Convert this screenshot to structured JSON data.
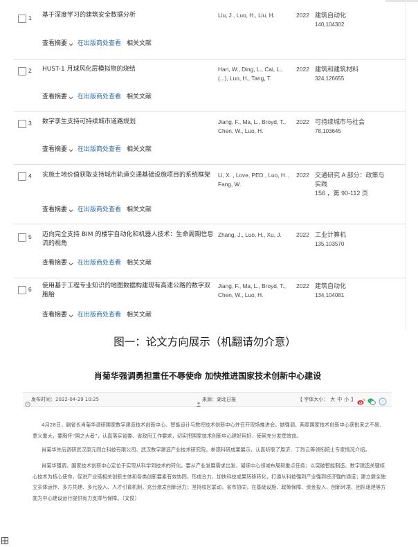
{
  "results": [
    {
      "index": "1",
      "title_lines": [
        "基于深度学习的建筑安全数据分析"
      ],
      "author_lines": [
        "Liu, J., Luo, H., Liu, H."
      ],
      "year": "2022",
      "source_lines": [
        "建筑自动化",
        "140,104302"
      ]
    },
    {
      "index": "2",
      "title_lines": [
        "HUST-1 月球风化层模拟物的烧结"
      ],
      "author_lines": [
        "Han, W., Ding, L., Cai, L.,",
        "(...), Luo, H., Tang, T."
      ],
      "year": "2022",
      "source_lines": [
        "建筑和建筑材料",
        "324,126655"
      ]
    },
    {
      "index": "3",
      "title_lines": [
        "数字孪生支持可持续城市道路规划"
      ],
      "author_lines": [
        "Jiang, F., Ma, L., Broyd, T.,",
        "Chen, W., Luo, H."
      ],
      "year": "2022",
      "source_lines": [
        "可持续城市与社会",
        "78,103645"
      ]
    },
    {
      "index": "4",
      "title_lines": [
        "实施土地价值获取支持城市轨道交通基础设施项目的系统框架"
      ],
      "author_lines": [
        "Li, X. , Love, PED , Luo, H. ,",
        "Fang, W."
      ],
      "year": "2022",
      "source_lines": [
        "交通研究 A 部分：政策与",
        "实践",
        "156 ，第 90-112 页"
      ]
    },
    {
      "index": "5",
      "title_lines": [
        "迈向完全支持 BIM 的楼宇自动化和机器人技术：生命周期信息",
        "流的视角"
      ],
      "author_lines": [
        "Zhang, J., Luo, H., Xu, J."
      ],
      "year": "2022",
      "source_lines": [
        "工业计算机",
        "135,103570"
      ]
    },
    {
      "index": "6",
      "title_lines": [
        "使用基于工程专业知识的地图数据构建现有高速公路的数字双",
        "胞胎"
      ],
      "author_lines": [
        "Jiang, F., Ma, L., Broyd, T.,",
        "Chen, W., Luo, H."
      ],
      "year": "2022",
      "source_lines": [
        "建筑自动化",
        "134,104081"
      ]
    }
  ],
  "result_actions": {
    "abstract": "查看摘要",
    "abstract_icon": "chevron-down-icon",
    "publisher": "在出版商处查看",
    "related": "相关文献"
  },
  "caption_1": "图一：论文方向展示（机翻请勿介意）",
  "news": {
    "title": "肖菊华强调勇担重任不辱使命 加快推进国家技术创新中心建设",
    "published": "发布时间：2022-04-29 10:25",
    "published_icon": "clock-icon",
    "source": "来源：湖北日报",
    "source_icon": "source-icon",
    "font_size": {
      "label": "【 字体大小：",
      "large": "大",
      "medium": "中",
      "small": "小",
      "end": "】"
    },
    "share_icons": [
      "weibo-icon",
      "wechat-icon",
      "qzone-icon"
    ],
    "paragraphs": [
      [
        "4月28日，副省长肖菊华调研国家数字建造技术创新中心、智能设计与数控技术创新中心并召开现场推进会。她强调，两家国家技术创新中心获批来之不易、",
        "意义重大，要胸怀“国之大者”，认真落实省委、省政府工作要求，切实把国家技术创新中心建好用好，使其充分发挥效益。"
      ],
      [
        "肖菊华先后调研武汉原元同立科技有限公司、武汉数字建造产业技术研究院，参观科研成果展示，认真听取了周济、丁烈云等领衔院士专家情况介绍。"
      ],
      [
        "肖菊华强调，国家技术创新中心定位于实现从科学到技术的转化。要从产业发展需求出发，凝练中心领域布局和重点任务；以突破智能制造、数字建造关键核",
        "心技术为核心使命，促进产业链相关创新主体和各类创新要素有效协同，形成合力，加快科技成果转移转化，打通从科技强到产业强到经济强的通道；建立健全独",
        "立实体运作、多方共建、多元投入、人才引育机制，充分激发创新活力；坚持校区联动，省市协同，在基础设施、政策保障、资金投入、创新环境、团队组建等方",
        "面为中心建设运行提供有力支撑与保障。（文俊）"
      ]
    ]
  },
  "bottom_icon": "grid-icon",
  "colors": {
    "link_blue": "#2e6da4",
    "weibo": "#e6162d",
    "wechat": "#2aae67",
    "qzone": "#8fb3d9"
  }
}
